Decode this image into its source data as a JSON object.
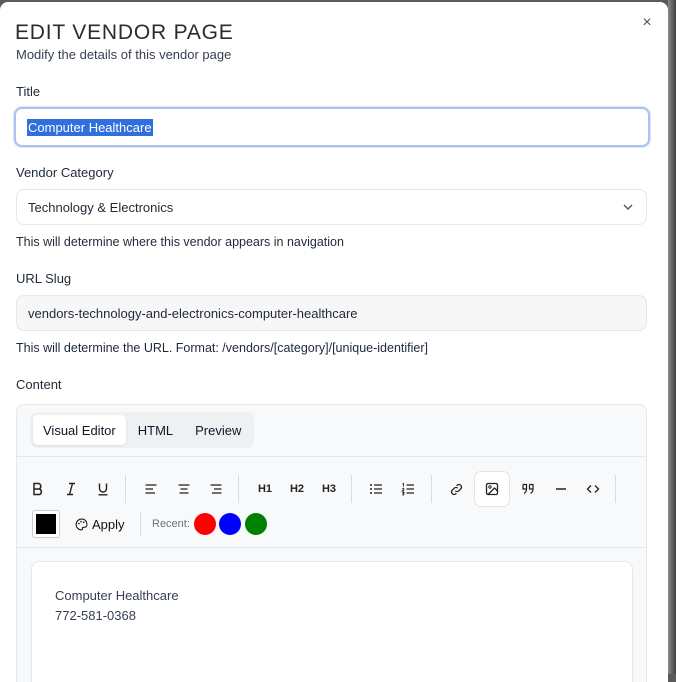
{
  "dialog": {
    "title": "EDIT VENDOR PAGE",
    "subtitle": "Modify the details of this vendor page",
    "close_icon": "×"
  },
  "fields": {
    "title": {
      "label": "Title",
      "value": "Computer Healthcare"
    },
    "category": {
      "label": "Vendor Category",
      "value": "Technology & Electronics",
      "help": "This will determine where this vendor appears in navigation"
    },
    "slug": {
      "label": "URL Slug",
      "value": "vendors-technology-and-electronics-computer-healthcare",
      "help": "This will determine the URL. Format: /vendors/[category]/[unique-identifier]"
    },
    "content": {
      "label": "Content"
    }
  },
  "editor": {
    "tabs": [
      "Visual Editor",
      "HTML",
      "Preview"
    ],
    "active_tab": "Visual Editor",
    "toolbar": {
      "bold": "B",
      "italic": "I",
      "underline": "U",
      "h1": "H1",
      "h2": "H2",
      "h3": "H3",
      "apply_label": "Apply",
      "recent_label": "Recent:",
      "current_color": "#000000",
      "recent_colors": [
        "#ff0000",
        "#0000ff",
        "#008000"
      ]
    },
    "content_lines": [
      "Computer Healthcare",
      "772-581-0368"
    ]
  },
  "colors": {
    "focus_ring": "#a9c3ee",
    "selection": "#2f6fde"
  }
}
